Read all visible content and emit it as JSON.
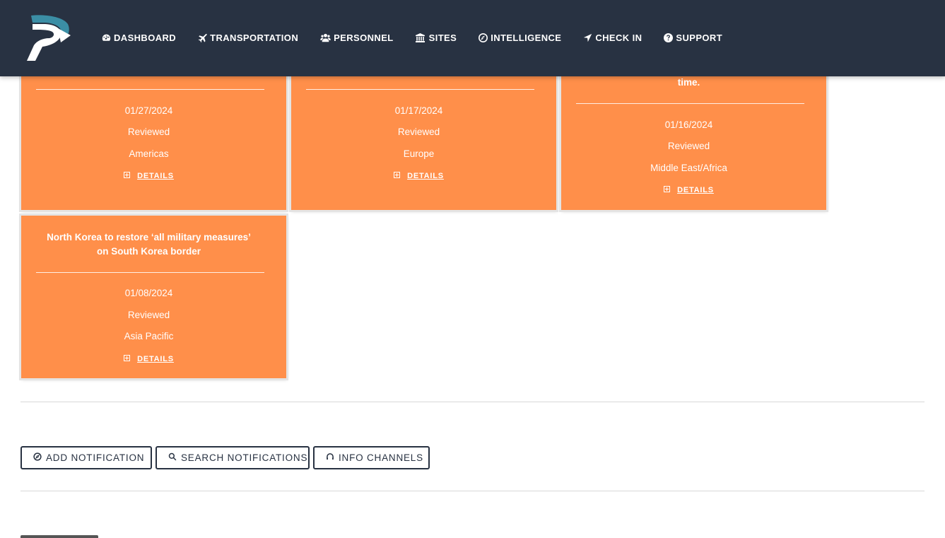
{
  "nav": {
    "items": [
      {
        "label": "DASHBOARD",
        "icon": "tachometer-icon"
      },
      {
        "label": "TRANSPORTATION",
        "icon": "plane-icon"
      },
      {
        "label": "PERSONNEL",
        "icon": "users-icon"
      },
      {
        "label": "SITES",
        "icon": "bank-icon"
      },
      {
        "label": "INTELLIGENCE",
        "icon": "compass-icon"
      },
      {
        "label": "CHECK IN",
        "icon": "location-arrow-icon"
      },
      {
        "label": "SUPPORT",
        "icon": "question-circle-icon"
      }
    ]
  },
  "cards": [
    {
      "title": "",
      "date": "01/27/2024",
      "status": "Reviewed",
      "region": "Americas",
      "details_label": "DETAILS"
    },
    {
      "title": "",
      "date": "01/17/2024",
      "status": "Reviewed",
      "region": "Europe",
      "details_label": "DETAILS"
    },
    {
      "title": "time.",
      "date": "01/16/2024",
      "status": "Reviewed",
      "region": "Middle East/Africa",
      "details_label": "DETAILS"
    },
    {
      "title_line1": "North Korea to restore ‘all military measures’",
      "title_line2": "on South Korea border",
      "date": "01/08/2024",
      "status": "Reviewed",
      "region": "Asia Pacific",
      "details_label": "DETAILS"
    }
  ],
  "actions": {
    "add_notification": "ADD NOTIFICATION",
    "search_notifications": "SEARCH NOTIFICATIONS",
    "info_channels": "INFO CHANNELS"
  },
  "colors": {
    "nav_bg": "#283242",
    "card_bg": "#ff8f4a",
    "logo_teal": "#3b8ea5"
  }
}
